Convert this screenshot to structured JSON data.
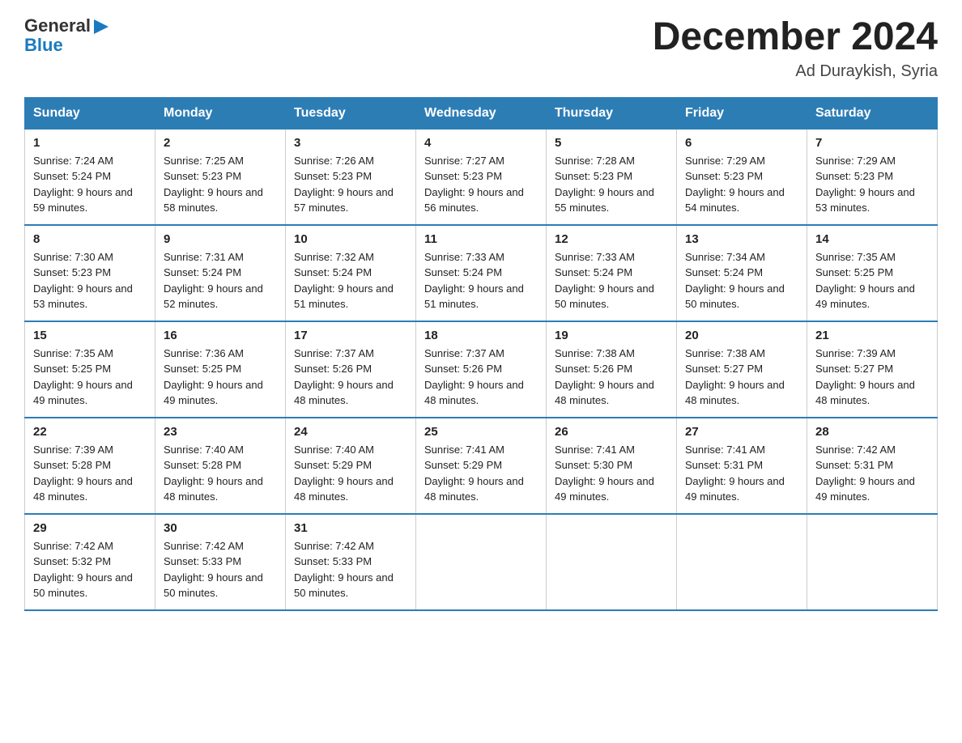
{
  "header": {
    "logo_text_general": "General",
    "logo_text_blue": "Blue",
    "month_title": "December 2024",
    "location": "Ad Duraykish, Syria"
  },
  "weekdays": [
    "Sunday",
    "Monday",
    "Tuesday",
    "Wednesday",
    "Thursday",
    "Friday",
    "Saturday"
  ],
  "weeks": [
    [
      {
        "day": "1",
        "sunrise": "7:24 AM",
        "sunset": "5:24 PM",
        "daylight": "9 hours and 59 minutes."
      },
      {
        "day": "2",
        "sunrise": "7:25 AM",
        "sunset": "5:23 PM",
        "daylight": "9 hours and 58 minutes."
      },
      {
        "day": "3",
        "sunrise": "7:26 AM",
        "sunset": "5:23 PM",
        "daylight": "9 hours and 57 minutes."
      },
      {
        "day": "4",
        "sunrise": "7:27 AM",
        "sunset": "5:23 PM",
        "daylight": "9 hours and 56 minutes."
      },
      {
        "day": "5",
        "sunrise": "7:28 AM",
        "sunset": "5:23 PM",
        "daylight": "9 hours and 55 minutes."
      },
      {
        "day": "6",
        "sunrise": "7:29 AM",
        "sunset": "5:23 PM",
        "daylight": "9 hours and 54 minutes."
      },
      {
        "day": "7",
        "sunrise": "7:29 AM",
        "sunset": "5:23 PM",
        "daylight": "9 hours and 53 minutes."
      }
    ],
    [
      {
        "day": "8",
        "sunrise": "7:30 AM",
        "sunset": "5:23 PM",
        "daylight": "9 hours and 53 minutes."
      },
      {
        "day": "9",
        "sunrise": "7:31 AM",
        "sunset": "5:24 PM",
        "daylight": "9 hours and 52 minutes."
      },
      {
        "day": "10",
        "sunrise": "7:32 AM",
        "sunset": "5:24 PM",
        "daylight": "9 hours and 51 minutes."
      },
      {
        "day": "11",
        "sunrise": "7:33 AM",
        "sunset": "5:24 PM",
        "daylight": "9 hours and 51 minutes."
      },
      {
        "day": "12",
        "sunrise": "7:33 AM",
        "sunset": "5:24 PM",
        "daylight": "9 hours and 50 minutes."
      },
      {
        "day": "13",
        "sunrise": "7:34 AM",
        "sunset": "5:24 PM",
        "daylight": "9 hours and 50 minutes."
      },
      {
        "day": "14",
        "sunrise": "7:35 AM",
        "sunset": "5:25 PM",
        "daylight": "9 hours and 49 minutes."
      }
    ],
    [
      {
        "day": "15",
        "sunrise": "7:35 AM",
        "sunset": "5:25 PM",
        "daylight": "9 hours and 49 minutes."
      },
      {
        "day": "16",
        "sunrise": "7:36 AM",
        "sunset": "5:25 PM",
        "daylight": "9 hours and 49 minutes."
      },
      {
        "day": "17",
        "sunrise": "7:37 AM",
        "sunset": "5:26 PM",
        "daylight": "9 hours and 48 minutes."
      },
      {
        "day": "18",
        "sunrise": "7:37 AM",
        "sunset": "5:26 PM",
        "daylight": "9 hours and 48 minutes."
      },
      {
        "day": "19",
        "sunrise": "7:38 AM",
        "sunset": "5:26 PM",
        "daylight": "9 hours and 48 minutes."
      },
      {
        "day": "20",
        "sunrise": "7:38 AM",
        "sunset": "5:27 PM",
        "daylight": "9 hours and 48 minutes."
      },
      {
        "day": "21",
        "sunrise": "7:39 AM",
        "sunset": "5:27 PM",
        "daylight": "9 hours and 48 minutes."
      }
    ],
    [
      {
        "day": "22",
        "sunrise": "7:39 AM",
        "sunset": "5:28 PM",
        "daylight": "9 hours and 48 minutes."
      },
      {
        "day": "23",
        "sunrise": "7:40 AM",
        "sunset": "5:28 PM",
        "daylight": "9 hours and 48 minutes."
      },
      {
        "day": "24",
        "sunrise": "7:40 AM",
        "sunset": "5:29 PM",
        "daylight": "9 hours and 48 minutes."
      },
      {
        "day": "25",
        "sunrise": "7:41 AM",
        "sunset": "5:29 PM",
        "daylight": "9 hours and 48 minutes."
      },
      {
        "day": "26",
        "sunrise": "7:41 AM",
        "sunset": "5:30 PM",
        "daylight": "9 hours and 49 minutes."
      },
      {
        "day": "27",
        "sunrise": "7:41 AM",
        "sunset": "5:31 PM",
        "daylight": "9 hours and 49 minutes."
      },
      {
        "day": "28",
        "sunrise": "7:42 AM",
        "sunset": "5:31 PM",
        "daylight": "9 hours and 49 minutes."
      }
    ],
    [
      {
        "day": "29",
        "sunrise": "7:42 AM",
        "sunset": "5:32 PM",
        "daylight": "9 hours and 50 minutes."
      },
      {
        "day": "30",
        "sunrise": "7:42 AM",
        "sunset": "5:33 PM",
        "daylight": "9 hours and 50 minutes."
      },
      {
        "day": "31",
        "sunrise": "7:42 AM",
        "sunset": "5:33 PM",
        "daylight": "9 hours and 50 minutes."
      },
      {
        "day": "",
        "sunrise": "",
        "sunset": "",
        "daylight": ""
      },
      {
        "day": "",
        "sunrise": "",
        "sunset": "",
        "daylight": ""
      },
      {
        "day": "",
        "sunrise": "",
        "sunset": "",
        "daylight": ""
      },
      {
        "day": "",
        "sunrise": "",
        "sunset": "",
        "daylight": ""
      }
    ]
  ],
  "labels": {
    "sunrise_prefix": "Sunrise: ",
    "sunset_prefix": "Sunset: ",
    "daylight_prefix": "Daylight: "
  }
}
